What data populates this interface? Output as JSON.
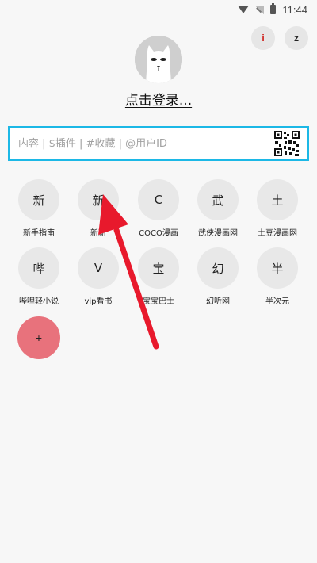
{
  "status_bar": {
    "time": "11:44"
  },
  "header": {
    "button_i": "i",
    "button_z": "z",
    "login_text": "点击登录..."
  },
  "search": {
    "placeholder": "内容 | $插件 | #收藏 | @用户ID",
    "accent_color": "#1cb8e6"
  },
  "sources": [
    {
      "glyph": "新",
      "label": "新手指南"
    },
    {
      "glyph": "新",
      "label": "新新"
    },
    {
      "glyph": "C",
      "label": "COCO漫画"
    },
    {
      "glyph": "武",
      "label": "武侠漫画网"
    },
    {
      "glyph": "土",
      "label": "土豆漫画网"
    },
    {
      "glyph": "哔",
      "label": "哔哩轻小说"
    },
    {
      "glyph": "V",
      "label": "vip看书"
    },
    {
      "glyph": "宝",
      "label": "宝宝巴士"
    },
    {
      "glyph": "幻",
      "label": "幻听网"
    },
    {
      "glyph": "半",
      "label": "半次元"
    }
  ],
  "add_button": {
    "label": "+",
    "color": "#e8727c"
  },
  "annotation": {
    "arrow_color": "#e8192c"
  }
}
